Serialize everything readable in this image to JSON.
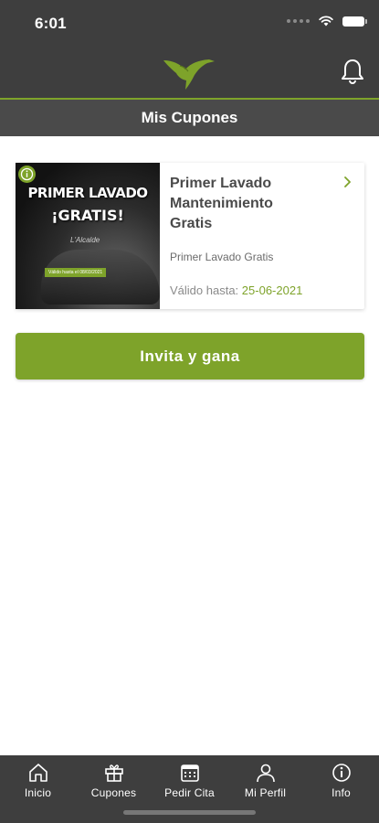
{
  "status_bar": {
    "time": "6:01"
  },
  "header": {
    "title": "Mis Cupones"
  },
  "coupon": {
    "image_text_line1": "PRIMER LAVADO",
    "image_text_line2": "¡GRATIS!",
    "image_brand": "L'Alcalde",
    "image_validity": "Válido hasta el 08/03/2021",
    "title": "Primer Lavado Mantenimiento Gratis",
    "subtitle": "Primer Lavado Gratis",
    "validity_label": "Válido hasta:",
    "validity_date": "25-06-2021"
  },
  "invite_button": {
    "label": "Invita y gana"
  },
  "tabs": [
    {
      "label": "Inicio",
      "icon": "home-icon"
    },
    {
      "label": "Cupones",
      "icon": "gift-icon"
    },
    {
      "label": "Pedir Cita",
      "icon": "calendar-icon"
    },
    {
      "label": "Mi Perfil",
      "icon": "user-icon"
    },
    {
      "label": "Info",
      "icon": "info-icon"
    }
  ],
  "colors": {
    "accent": "#7ea32a",
    "header_bg": "#3e3e3e",
    "title_bar_bg": "#4a4a4a"
  }
}
